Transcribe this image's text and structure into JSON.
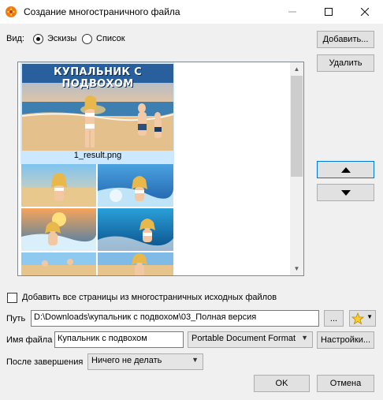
{
  "window": {
    "title": "Создание многостраничного файла",
    "minimize_icon": "minimize-icon",
    "maximize_icon": "maximize-icon",
    "close_icon": "close-icon"
  },
  "view": {
    "label": "Вид:",
    "thumbnails_label": "Эскизы",
    "list_label": "Список",
    "selected": "thumbnails"
  },
  "buttons": {
    "add": "Добавить...",
    "delete": "Удалить",
    "move_up_icon": "triangle-up-icon",
    "move_down_icon": "triangle-down-icon",
    "browse": "...",
    "settings": "Настройки...",
    "ok": "OK",
    "cancel": "Отмена"
  },
  "thumbnails": [
    {
      "caption": "1_result.png",
      "banner": "КУПАЛЬНИК С ПОДВОХОМ",
      "selected": true
    },
    {
      "caption": "",
      "banner": "",
      "selected": false
    }
  ],
  "options": {
    "add_all_pages_label": "Добавить все страницы из многостраничных исходных файлов",
    "add_all_pages_checked": false
  },
  "path": {
    "label": "Путь",
    "value": "D:\\Downloads\\купальник с подвохом\\03_Полная версия",
    "favorite_icon": "star-icon"
  },
  "filename": {
    "label": "Имя файла",
    "value": "Купальник с подвохом",
    "format": "Portable Document Format"
  },
  "after": {
    "label": "После завершения",
    "value": "Ничего не делать"
  }
}
